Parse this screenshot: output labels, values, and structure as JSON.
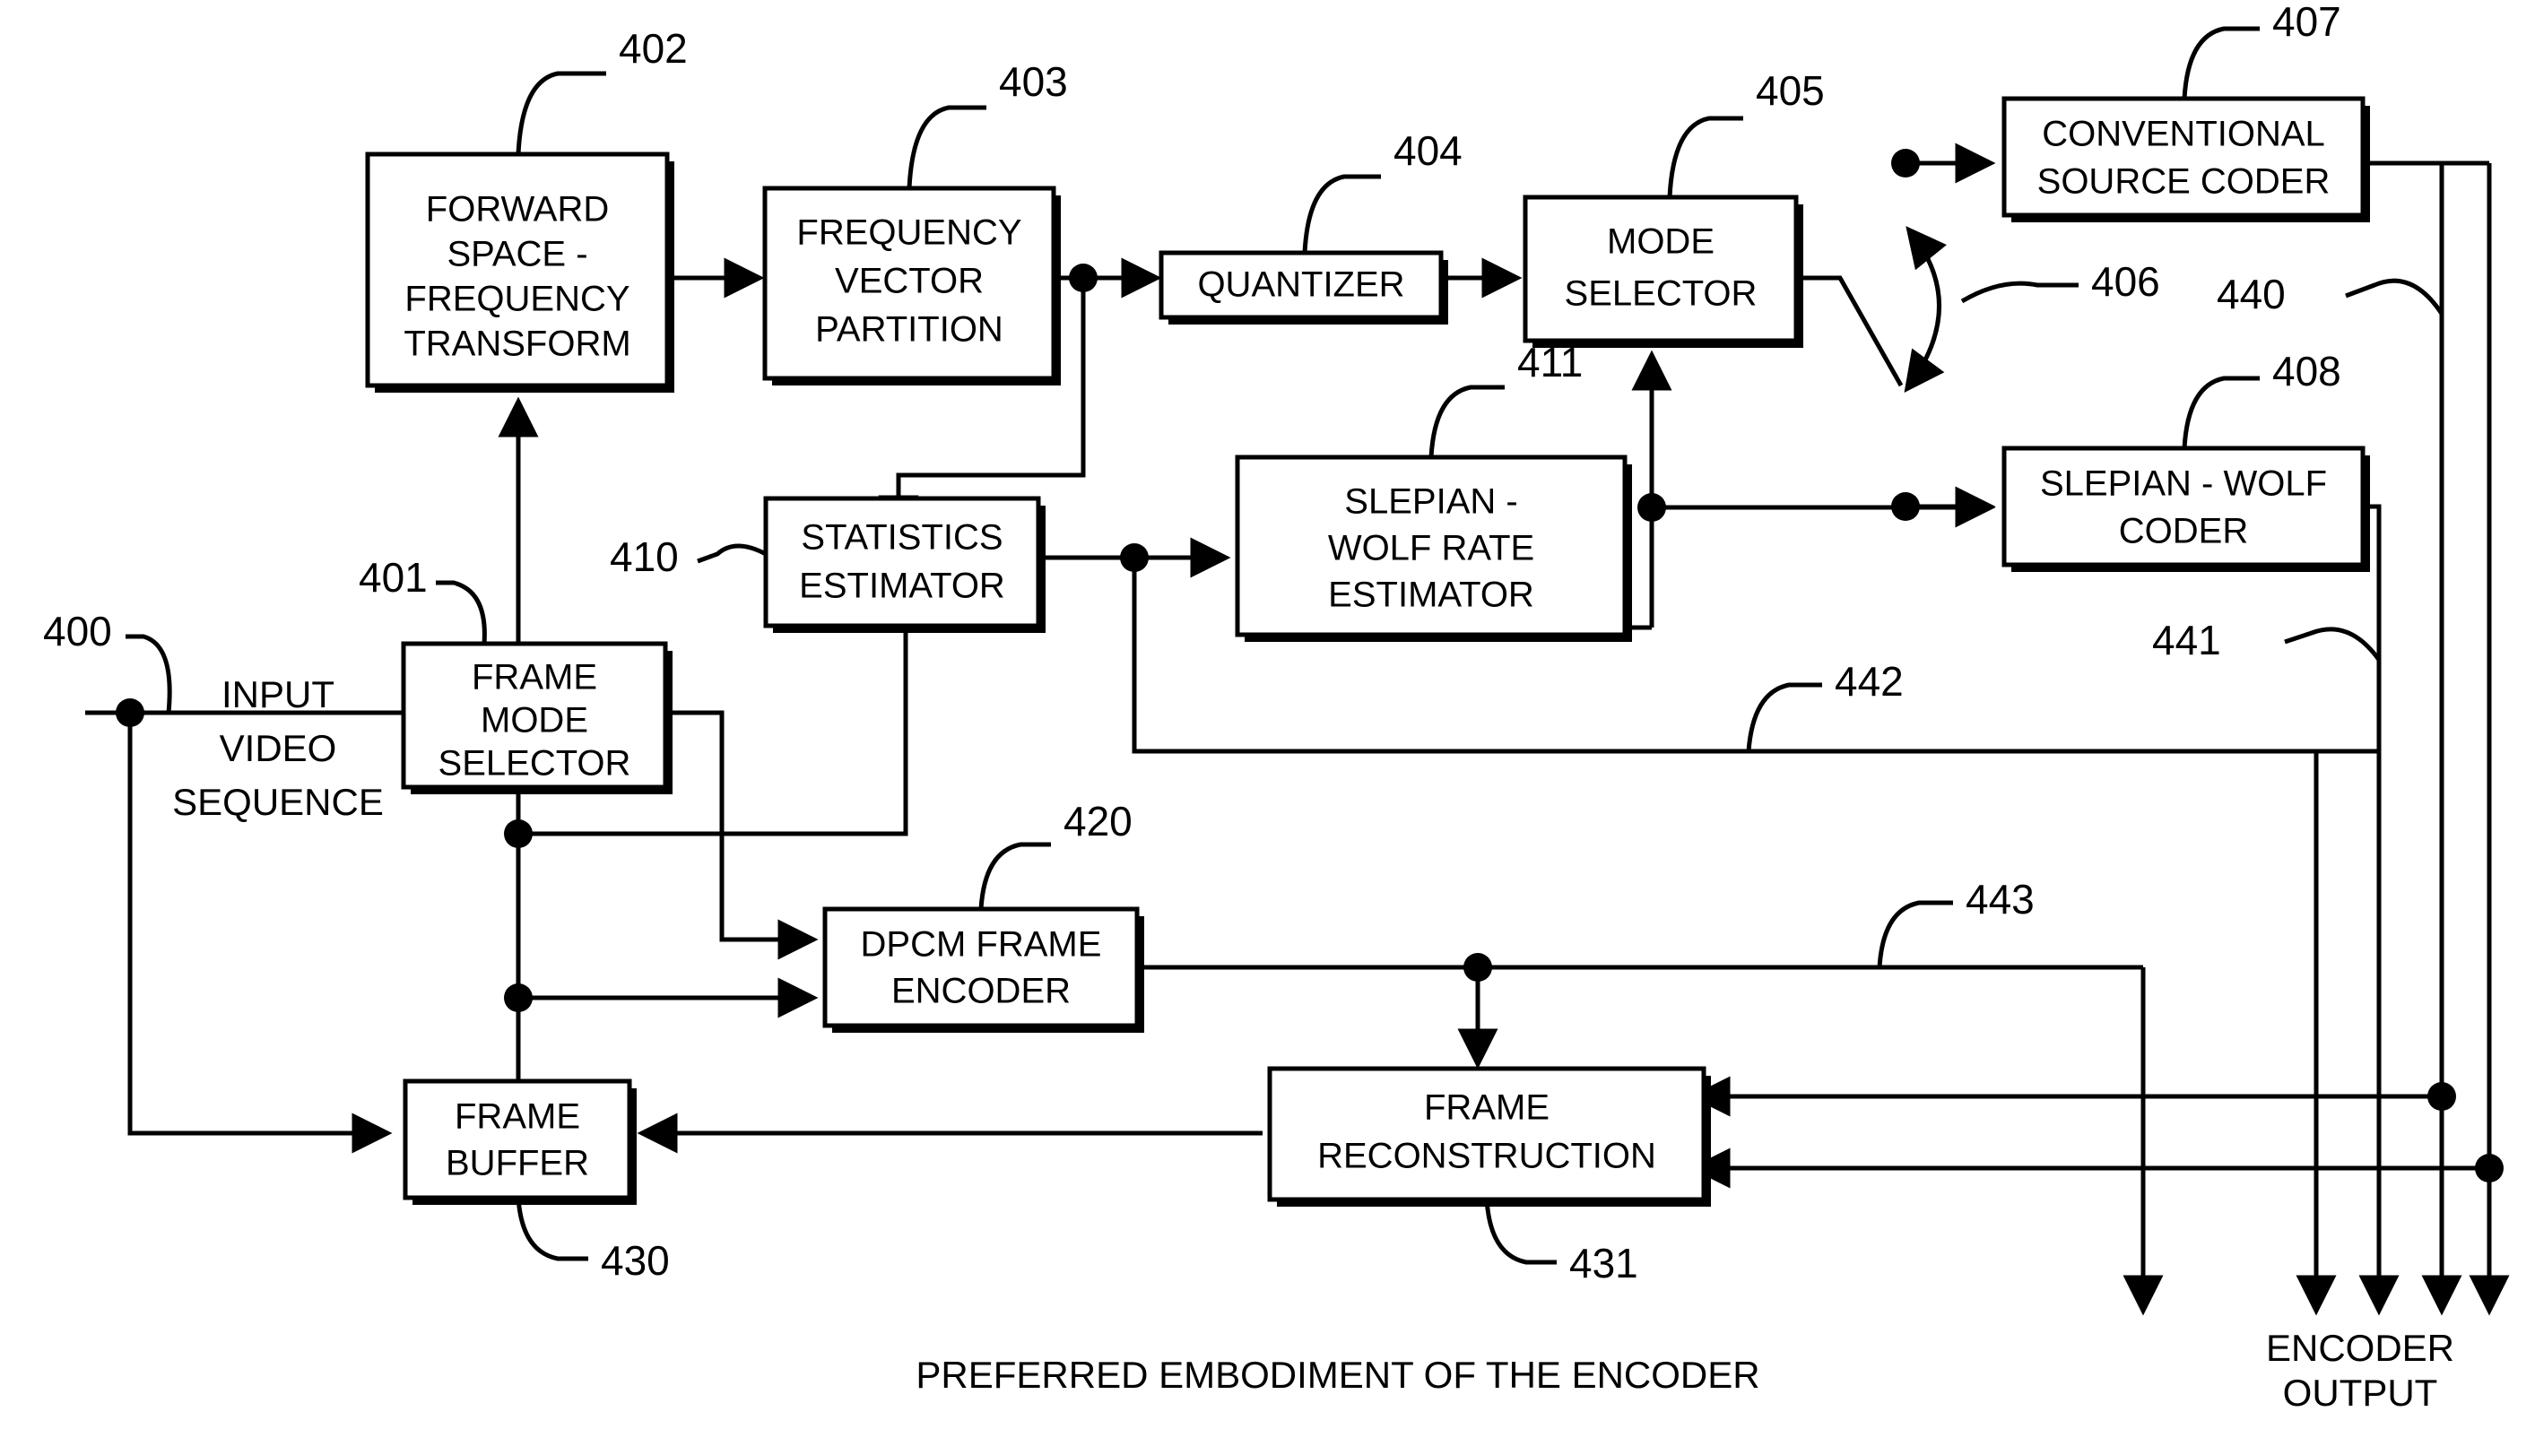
{
  "figure": {
    "caption": "PREFERRED EMBODIMENT OF THE ENCODER",
    "input_label_line1": "INPUT",
    "input_label_line2": "VIDEO",
    "input_label_line3": "SEQUENCE",
    "output_label_line1": "ENCODER",
    "output_label_line2": "OUTPUT"
  },
  "blocks": [
    {
      "id": "forward-transform",
      "ref": "402",
      "lines": [
        "FORWARD",
        "SPACE -",
        "FREQUENCY",
        "TRANSFORM"
      ]
    },
    {
      "id": "frequency-vector-partition",
      "ref": "403",
      "lines": [
        "FREQUENCY",
        "VECTOR",
        "PARTITION"
      ]
    },
    {
      "id": "quantizer",
      "ref": "404",
      "lines": [
        "QUANTIZER"
      ]
    },
    {
      "id": "mode-selector",
      "ref": "405",
      "lines": [
        "MODE",
        "SELECTOR"
      ]
    },
    {
      "id": "conventional-source-coder",
      "ref": "407",
      "lines": [
        "CONVENTIONAL",
        "SOURCE CODER"
      ]
    },
    {
      "id": "slepian-wolf-coder",
      "ref": "408",
      "lines": [
        "SLEPIAN - WOLF",
        "CODER"
      ]
    },
    {
      "id": "slepian-wolf-rate-estimator",
      "ref": "411",
      "lines": [
        "SLEPIAN -",
        "WOLF RATE",
        "ESTIMATOR"
      ]
    },
    {
      "id": "statistics-estimator",
      "ref": "410",
      "lines": [
        "STATISTICS",
        "ESTIMATOR"
      ]
    },
    {
      "id": "frame-mode-selector",
      "ref": "401",
      "lines": [
        "FRAME",
        "MODE",
        "SELECTOR"
      ]
    },
    {
      "id": "dpcm-frame-encoder",
      "ref": "420",
      "lines": [
        "DPCM FRAME",
        "ENCODER"
      ]
    },
    {
      "id": "frame-buffer",
      "ref": "430",
      "lines": [
        "FRAME",
        "BUFFER"
      ]
    },
    {
      "id": "frame-reconstruction",
      "ref": "431",
      "lines": [
        "FRAME",
        "RECONSTRUCTION"
      ]
    }
  ],
  "reference_numerals": {
    "input_sequence": "400",
    "frame_mode_selector": "401",
    "forward_transform": "402",
    "frequency_vector_partition": "403",
    "quantizer": "404",
    "mode_selector": "405",
    "switch": "406",
    "conventional_source_coder": "407",
    "slepian_wolf_coder": "408",
    "statistics_estimator": "410",
    "slepian_wolf_rate_estimator": "411",
    "dpcm_frame_encoder": "420",
    "frame_buffer": "430",
    "frame_reconstruction": "431",
    "bus_440": "440",
    "bus_441": "441",
    "bus_442": "442",
    "bus_443": "443"
  },
  "colors": {
    "line": "#000000",
    "background": "#ffffff",
    "text": "#000000"
  }
}
